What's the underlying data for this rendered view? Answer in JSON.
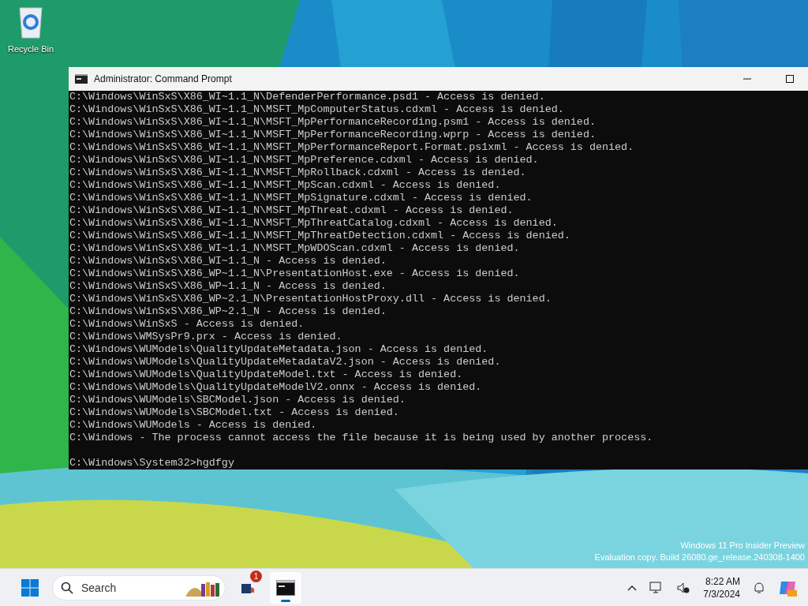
{
  "desktop": {
    "icons": [
      {
        "label": "Recycle Bin"
      }
    ],
    "watermark": [
      "Windows 11 Pro Insider Preview",
      "Evaluation copy. Build 26080.ge_release.240308-1400"
    ]
  },
  "window": {
    "title": "Administrator: Command Prompt",
    "output_lines": [
      "C:\\Windows\\WinSxS\\X86_WI~1.1_N\\DefenderPerformance.psd1 - Access is denied.",
      "C:\\Windows\\WinSxS\\X86_WI~1.1_N\\MSFT_MpComputerStatus.cdxml - Access is denied.",
      "C:\\Windows\\WinSxS\\X86_WI~1.1_N\\MSFT_MpPerformanceRecording.psm1 - Access is denied.",
      "C:\\Windows\\WinSxS\\X86_WI~1.1_N\\MSFT_MpPerformanceRecording.wprp - Access is denied.",
      "C:\\Windows\\WinSxS\\X86_WI~1.1_N\\MSFT_MpPerformanceReport.Format.ps1xml - Access is denied.",
      "C:\\Windows\\WinSxS\\X86_WI~1.1_N\\MSFT_MpPreference.cdxml - Access is denied.",
      "C:\\Windows\\WinSxS\\X86_WI~1.1_N\\MSFT_MpRollback.cdxml - Access is denied.",
      "C:\\Windows\\WinSxS\\X86_WI~1.1_N\\MSFT_MpScan.cdxml - Access is denied.",
      "C:\\Windows\\WinSxS\\X86_WI~1.1_N\\MSFT_MpSignature.cdxml - Access is denied.",
      "C:\\Windows\\WinSxS\\X86_WI~1.1_N\\MSFT_MpThreat.cdxml - Access is denied.",
      "C:\\Windows\\WinSxS\\X86_WI~1.1_N\\MSFT_MpThreatCatalog.cdxml - Access is denied.",
      "C:\\Windows\\WinSxS\\X86_WI~1.1_N\\MSFT_MpThreatDetection.cdxml - Access is denied.",
      "C:\\Windows\\WinSxS\\X86_WI~1.1_N\\MSFT_MpWDOScan.cdxml - Access is denied.",
      "C:\\Windows\\WinSxS\\X86_WI~1.1_N - Access is denied.",
      "C:\\Windows\\WinSxS\\X86_WP~1.1_N\\PresentationHost.exe - Access is denied.",
      "C:\\Windows\\WinSxS\\X86_WP~1.1_N - Access is denied.",
      "C:\\Windows\\WinSxS\\X86_WP~2.1_N\\PresentationHostProxy.dll - Access is denied.",
      "C:\\Windows\\WinSxS\\X86_WP~2.1_N - Access is denied.",
      "C:\\Windows\\WinSxS - Access is denied.",
      "C:\\Windows\\WMSysPr9.prx - Access is denied.",
      "C:\\Windows\\WUModels\\QualityUpdateMetadata.json - Access is denied.",
      "C:\\Windows\\WUModels\\QualityUpdateMetadataV2.json - Access is denied.",
      "C:\\Windows\\WUModels\\QualityUpdateModel.txt - Access is denied.",
      "C:\\Windows\\WUModels\\QualityUpdateModelV2.onnx - Access is denied.",
      "C:\\Windows\\WUModels\\SBCModel.json - Access is denied.",
      "C:\\Windows\\WUModels\\SBCModel.txt - Access is denied.",
      "C:\\Windows\\WUModels - Access is denied.",
      "C:\\Windows - The process cannot access the file because it is being used by another process."
    ],
    "prompt": "C:\\Windows\\System32>hgdfgy"
  },
  "taskbar": {
    "search": {
      "placeholder": "Search"
    },
    "apps": [
      {
        "kind": "defender",
        "badge": "1",
        "active": false
      },
      {
        "kind": "terminal",
        "active": true
      }
    ],
    "clock": {
      "time": "8:22 AM",
      "date": "7/3/2024"
    }
  }
}
